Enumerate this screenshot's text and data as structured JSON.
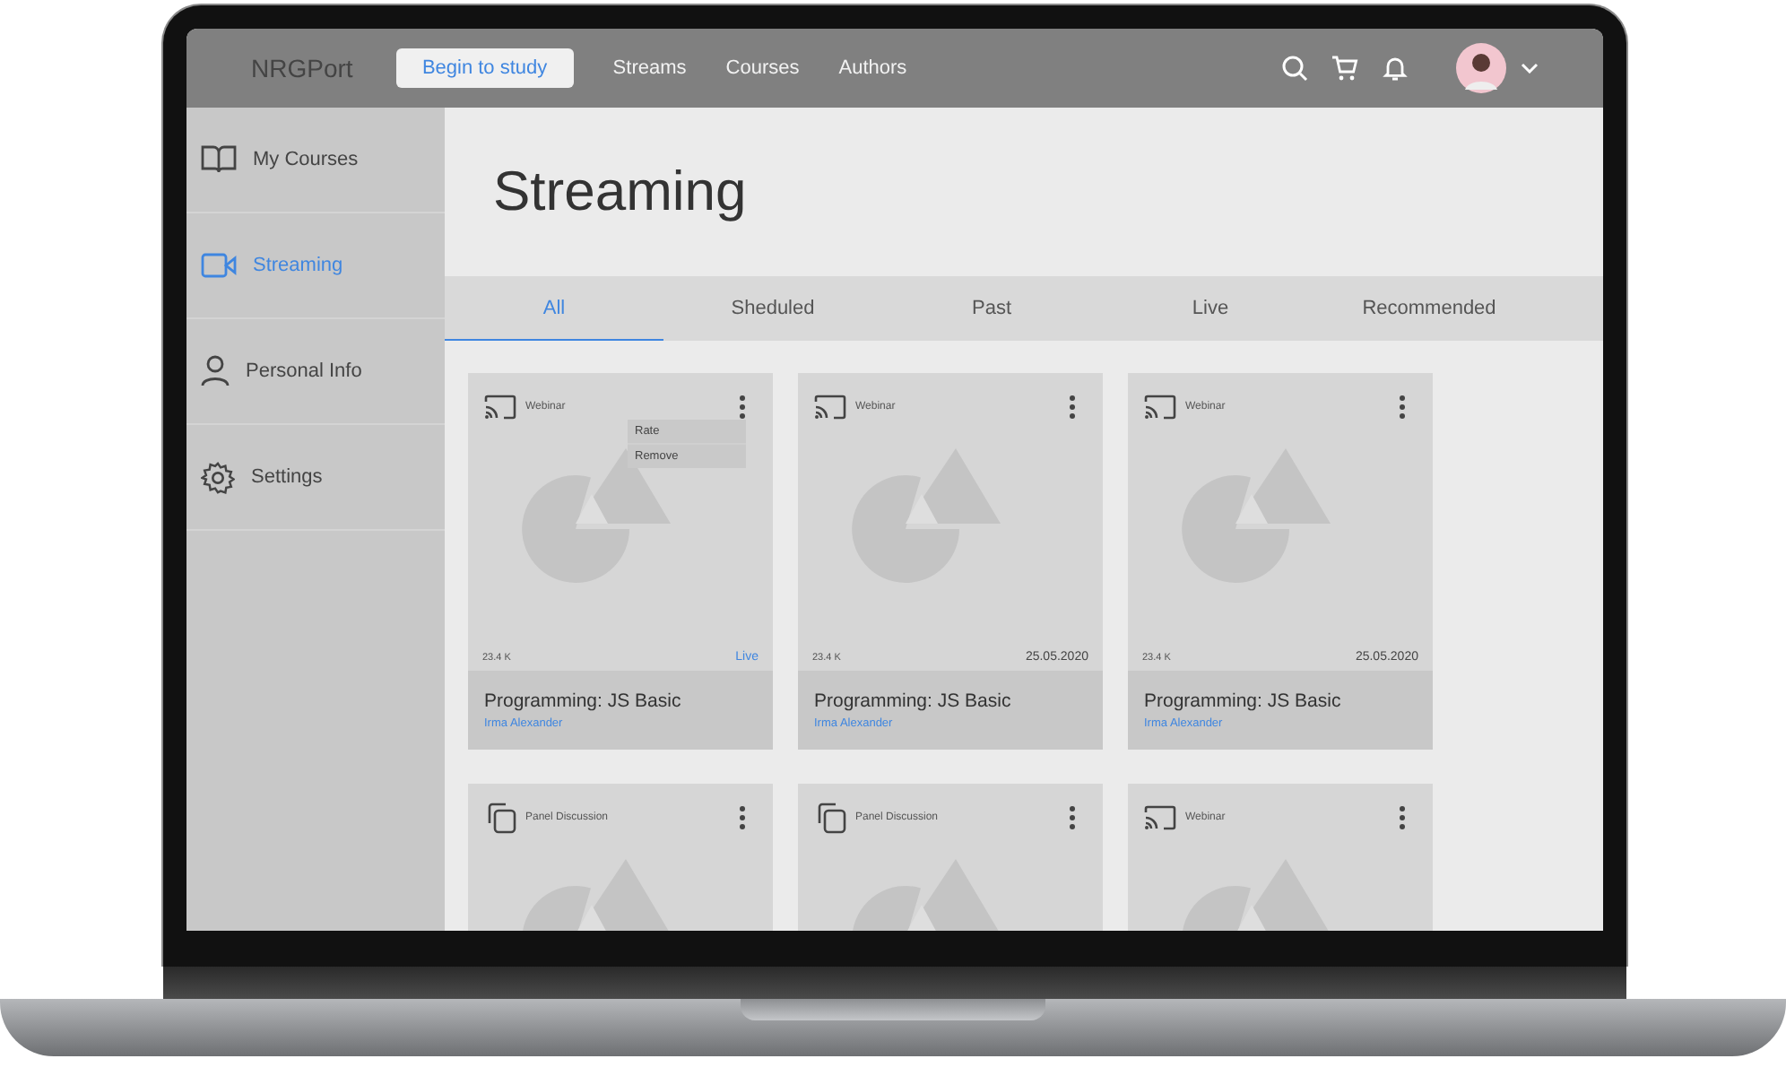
{
  "header": {
    "logo": "NRGPort",
    "cta": "Begin to study",
    "nav": [
      "Streams",
      "Courses",
      "Authors"
    ]
  },
  "sidebar": {
    "items": [
      {
        "label": "My Courses",
        "kind": "book",
        "selected": false
      },
      {
        "label": "Streaming",
        "kind": "video",
        "selected": true
      },
      {
        "label": "Personal Info",
        "kind": "person",
        "selected": false
      },
      {
        "label": "Settings",
        "kind": "gear",
        "selected": false
      }
    ]
  },
  "page_title": "Streaming",
  "tabs": [
    {
      "label": "All",
      "selected": true
    },
    {
      "label": "Sheduled",
      "selected": false
    },
    {
      "label": "Past",
      "selected": false
    },
    {
      "label": "Live",
      "selected": false
    },
    {
      "label": "Recommended",
      "selected": false
    }
  ],
  "cards": [
    {
      "kind": "webinar",
      "type": "Webinar",
      "menu": [
        "Rate",
        "Remove"
      ],
      "views": "23.4 K",
      "status": {
        "kind": "live",
        "text": "Live"
      },
      "title": "Programming: JS Basic",
      "author": "Irma Alexander"
    },
    {
      "kind": "webinar",
      "type": "Webinar",
      "views": "23.4 K",
      "status": {
        "kind": "date",
        "text": "25.05.2020"
      },
      "title": "Programming: JS Basic",
      "author": "Irma Alexander"
    },
    {
      "kind": "webinar",
      "type": "Webinar",
      "views": "23.4 K",
      "status": {
        "kind": "date",
        "text": "25.05.2020"
      },
      "title": "Programming: JS Basic",
      "author": "Irma Alexander"
    },
    {
      "kind": "panel",
      "type": "Panel Discussion"
    },
    {
      "kind": "panel",
      "type": "Panel Discussion"
    },
    {
      "kind": "webinar",
      "type": "Webinar"
    }
  ]
}
